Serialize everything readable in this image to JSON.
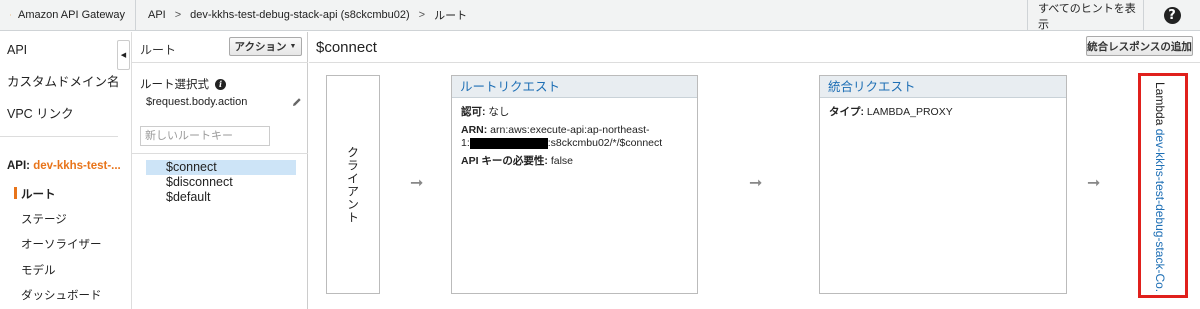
{
  "topbar": {
    "brand": "Amazon API Gateway",
    "breadcrumbs": [
      "API",
      "dev-kkhs-test-debug-stack-api (s8ckcmbu02)",
      "ルート"
    ],
    "hints": "すべてのヒントを表示",
    "help": "?"
  },
  "leftnav": {
    "items": [
      "API",
      "カスタムドメイン名",
      "VPC リンク"
    ],
    "api_prefix": "API:",
    "api_name": "dev-kkhs-test-...",
    "sub_items": [
      "ルート",
      "ステージ",
      "オーソライザー",
      "モデル",
      "ダッシュボード"
    ],
    "active_sub": "ルート"
  },
  "routes_panel": {
    "title": "ルート",
    "actions_label": "アクション",
    "route_selection_label": "ルート選択式",
    "route_selection_value": "$request.body.action",
    "new_route_placeholder": "新しいルートキー",
    "routes": [
      "$connect",
      "$disconnect",
      "$default"
    ],
    "selected_route": "$connect"
  },
  "main": {
    "title": "$connect",
    "integration_response_button": "統合レスポンスの追加",
    "client_label": "クライアント",
    "route_request": {
      "title": "ルートリクエスト",
      "auth_label": "認可:",
      "auth_value": "なし",
      "arn_label": "ARN:",
      "arn_line1": "arn:aws:execute-api:ap-northeast-",
      "arn_line2_prefix": "1:",
      "arn_line2_suffix": ":s8ckcmbu02/*/$connect",
      "apikey_label": "API キーの必要性:",
      "apikey_value": "false"
    },
    "integration_request": {
      "title": "統合リクエスト",
      "type_label": "タイプ:",
      "type_value": "LAMBDA_PROXY"
    },
    "lambda": {
      "prefix": "Lambda",
      "name": "dev-kkhs-test-debug-stack-Co..."
    },
    "arrow_glyph": "➞"
  },
  "colors": {
    "accent_orange": "#e8741a",
    "link_blue": "#1e6fb5",
    "highlight_red": "#e0201c",
    "selected_row": "#cde4f7"
  }
}
